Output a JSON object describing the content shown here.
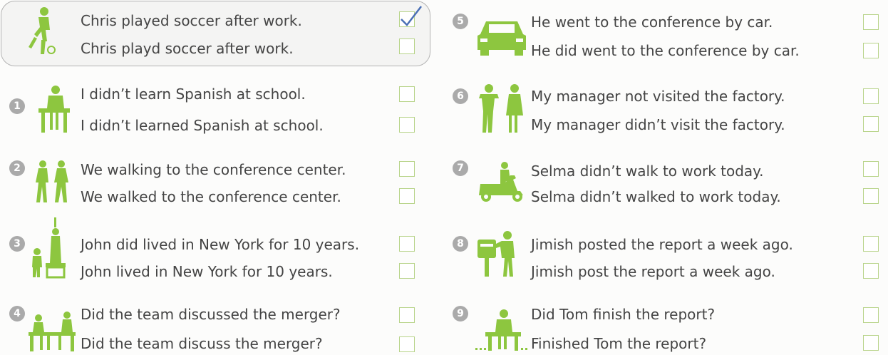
{
  "example": {
    "sentence_a": "Chris played soccer after work.",
    "sentence_b": "Chris playd soccer after work.",
    "checked": "a"
  },
  "items": [
    {
      "number": "1",
      "a": "I didn’t learn Spanish at school.",
      "b": "I didn’t learned Spanish at school.",
      "icon": "student-desk-icon"
    },
    {
      "number": "2",
      "a": "We walking to the conference center.",
      "b": "We walked to the conference center.",
      "icon": "walking-people-icon"
    },
    {
      "number": "3",
      "a": "John did lived in New York for 10 years.",
      "b": "John lived in New York for 10 years.",
      "icon": "statue-of-liberty-icon"
    },
    {
      "number": "4",
      "a": "Did the team discussed the merger?",
      "b": "Did the team discuss the merger?",
      "icon": "meeting-table-icon"
    },
    {
      "number": "5",
      "a": "He went to the conference by car.",
      "b": "He did went to the conference by car.",
      "icon": "car-icon"
    },
    {
      "number": "6",
      "a": "My manager not visited the factory.",
      "b": "My manager didn’t visit the factory.",
      "icon": "managers-icon"
    },
    {
      "number": "7",
      "a": "Selma didn’t walk to work today.",
      "b": "Selma didn’t walked to work today.",
      "icon": "scooter-icon"
    },
    {
      "number": "8",
      "a": "Jimish posted the report a week ago.",
      "b": "Jimish post the report a week ago.",
      "icon": "mailbox-icon"
    },
    {
      "number": "9",
      "a": "Did Tom finish the report?",
      "b": "Finished Tom the report?",
      "icon": "desk-worker-icon"
    }
  ],
  "colors": {
    "icon": "#8dc63f",
    "checkbox_border": "#b8d48a",
    "check": "#4a6fb5",
    "number_bg": "#aaaaaa"
  }
}
